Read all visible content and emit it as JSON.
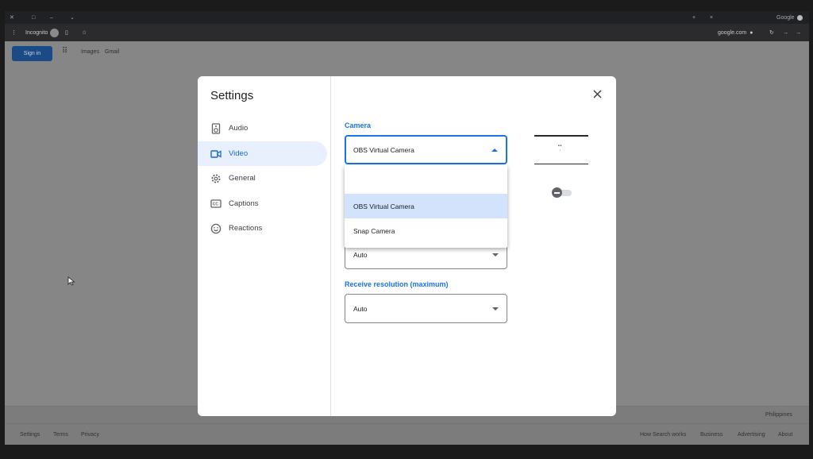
{
  "browser": {
    "tab_title": "Google",
    "url": "google.com",
    "incognito_label": "Incognito"
  },
  "page": {
    "signin_label": "Sign in",
    "header_links": [
      "Gmail",
      "Images"
    ],
    "footer_country": "Philippines",
    "footer_left": [
      "About",
      "Advertising",
      "Business",
      "How Search works"
    ],
    "footer_right": [
      "Privacy",
      "Terms",
      "Settings"
    ]
  },
  "settings": {
    "title": "Settings",
    "nav": [
      {
        "label": "Audio",
        "icon": "speaker-icon",
        "active": false
      },
      {
        "label": "Video",
        "icon": "videocam-icon",
        "active": true
      },
      {
        "label": "General",
        "icon": "gear-icon",
        "active": false
      },
      {
        "label": "Captions",
        "icon": "closed-captions-icon",
        "active": false
      },
      {
        "label": "Reactions",
        "icon": "smiley-icon",
        "active": false
      }
    ],
    "camera_label": "Camera",
    "camera_value": "OBS Virtual Camera",
    "camera_options": [
      "",
      "OBS Virtual Camera",
      "Snap Camera"
    ],
    "camera_selected_option": "OBS Virtual Camera",
    "send_resolution_value": "Auto",
    "receive_resolution_label": "Receive resolution (maximum)",
    "receive_resolution_value": "Auto",
    "accent_color": "#1a73e8"
  }
}
